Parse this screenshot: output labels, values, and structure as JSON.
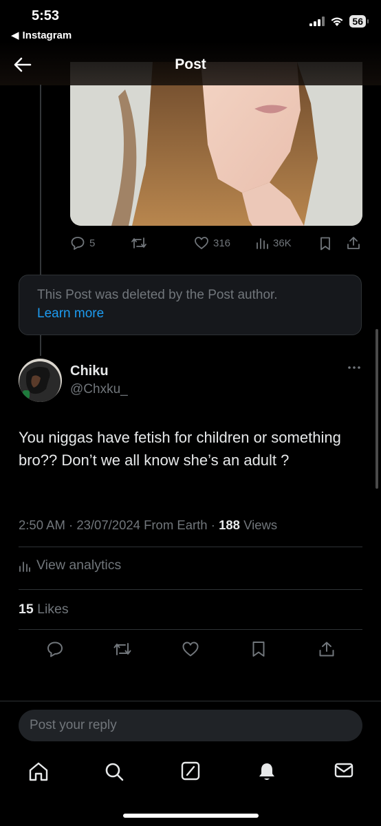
{
  "status_bar": {
    "time": "5:53",
    "back_app": "Instagram",
    "battery": "56"
  },
  "header": {
    "title": "Post"
  },
  "parent_post": {
    "metrics": {
      "replies": "5",
      "likes": "316",
      "views": "36K"
    }
  },
  "deleted_notice": {
    "text": "This Post was deleted by the Post author.",
    "link": "Learn more"
  },
  "post": {
    "author_name": "Chiku",
    "author_handle": "@Chxku_",
    "text": "You niggas have fetish for children or something bro?? Don’t we all know she’s an adult ?",
    "time": "2:50 AM",
    "date": "23/07/2024",
    "source": "From Earth",
    "views_count": "188",
    "views_label": "Views",
    "analytics_label": "View analytics",
    "likes_count": "15",
    "likes_label": "Likes"
  },
  "reply": {
    "placeholder": "Post your reply"
  },
  "icons": {
    "back": "arrow-left-icon",
    "reply": "speech-bubble-icon",
    "repost": "repost-icon",
    "like": "heart-icon",
    "views": "bar-chart-icon",
    "bookmark": "bookmark-icon",
    "share": "share-icon",
    "more": "more-dots-icon",
    "tabs": [
      "home-icon",
      "search-icon",
      "grok-icon",
      "bell-icon",
      "mail-icon"
    ]
  },
  "colors": {
    "accent": "#1d9bf0",
    "background": "#000000",
    "muted": "#71767b"
  }
}
